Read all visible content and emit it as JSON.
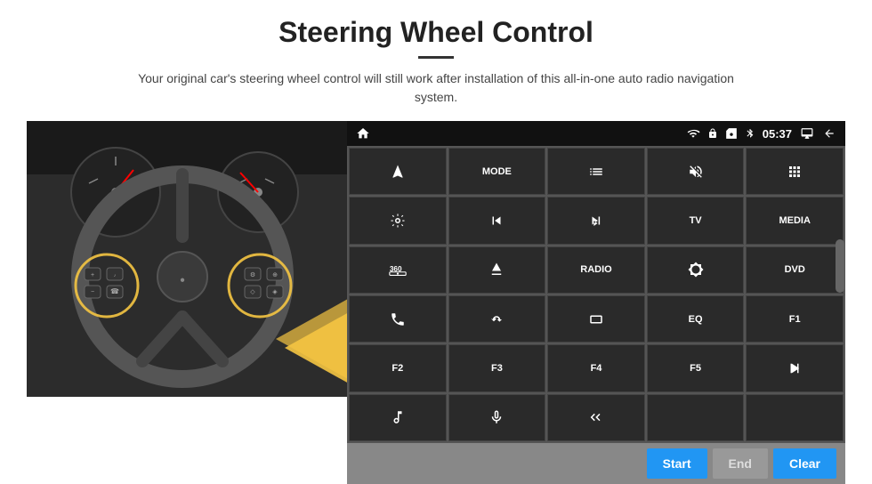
{
  "page": {
    "title": "Steering Wheel Control",
    "subtitle": "Your original car's steering wheel control will still work after installation of this all-in-one auto radio navigation system."
  },
  "status_bar": {
    "time": "05:37",
    "home_icon": "⌂"
  },
  "grid_buttons": [
    {
      "id": "b1",
      "label": "",
      "icon": "nav",
      "row": 1,
      "col": 1
    },
    {
      "id": "b2",
      "label": "MODE",
      "icon": "",
      "row": 1,
      "col": 2
    },
    {
      "id": "b3",
      "label": "",
      "icon": "list",
      "row": 1,
      "col": 3
    },
    {
      "id": "b4",
      "label": "",
      "icon": "mute",
      "row": 1,
      "col": 4
    },
    {
      "id": "b5",
      "label": "",
      "icon": "apps",
      "row": 1,
      "col": 5
    },
    {
      "id": "b6",
      "label": "",
      "icon": "settings-circle",
      "row": 2,
      "col": 1
    },
    {
      "id": "b7",
      "label": "",
      "icon": "prev",
      "row": 2,
      "col": 2
    },
    {
      "id": "b8",
      "label": "",
      "icon": "next",
      "row": 2,
      "col": 3
    },
    {
      "id": "b9",
      "label": "TV",
      "icon": "",
      "row": 2,
      "col": 4
    },
    {
      "id": "b10",
      "label": "MEDIA",
      "icon": "",
      "row": 2,
      "col": 5
    },
    {
      "id": "b11",
      "label": "",
      "icon": "360cam",
      "row": 3,
      "col": 1
    },
    {
      "id": "b12",
      "label": "",
      "icon": "eject",
      "row": 3,
      "col": 2
    },
    {
      "id": "b13",
      "label": "RADIO",
      "icon": "",
      "row": 3,
      "col": 3
    },
    {
      "id": "b14",
      "label": "",
      "icon": "brightness",
      "row": 3,
      "col": 4
    },
    {
      "id": "b15",
      "label": "DVD",
      "icon": "",
      "row": 3,
      "col": 5
    },
    {
      "id": "b16",
      "label": "",
      "icon": "phone",
      "row": 4,
      "col": 1
    },
    {
      "id": "b17",
      "label": "",
      "icon": "swipe",
      "row": 4,
      "col": 2
    },
    {
      "id": "b18",
      "label": "",
      "icon": "rectangle",
      "row": 4,
      "col": 3
    },
    {
      "id": "b19",
      "label": "EQ",
      "icon": "",
      "row": 4,
      "col": 4
    },
    {
      "id": "b20",
      "label": "F1",
      "icon": "",
      "row": 4,
      "col": 5
    },
    {
      "id": "b21",
      "label": "F2",
      "icon": "",
      "row": 5,
      "col": 1
    },
    {
      "id": "b22",
      "label": "F3",
      "icon": "",
      "row": 5,
      "col": 2
    },
    {
      "id": "b23",
      "label": "F4",
      "icon": "",
      "row": 5,
      "col": 3
    },
    {
      "id": "b24",
      "label": "F5",
      "icon": "",
      "row": 5,
      "col": 4
    },
    {
      "id": "b25",
      "label": "",
      "icon": "playpause",
      "row": 5,
      "col": 5
    },
    {
      "id": "b26",
      "label": "",
      "icon": "music",
      "row": 6,
      "col": 1
    },
    {
      "id": "b27",
      "label": "",
      "icon": "mic",
      "row": 6,
      "col": 2
    },
    {
      "id": "b28",
      "label": "",
      "icon": "vol-down-up",
      "row": 6,
      "col": 3
    },
    {
      "id": "b29",
      "label": "",
      "icon": "",
      "row": 6,
      "col": 4
    },
    {
      "id": "b30",
      "label": "",
      "icon": "",
      "row": 6,
      "col": 5
    }
  ],
  "bottom_bar": {
    "start_label": "Start",
    "end_label": "End",
    "clear_label": "Clear"
  }
}
